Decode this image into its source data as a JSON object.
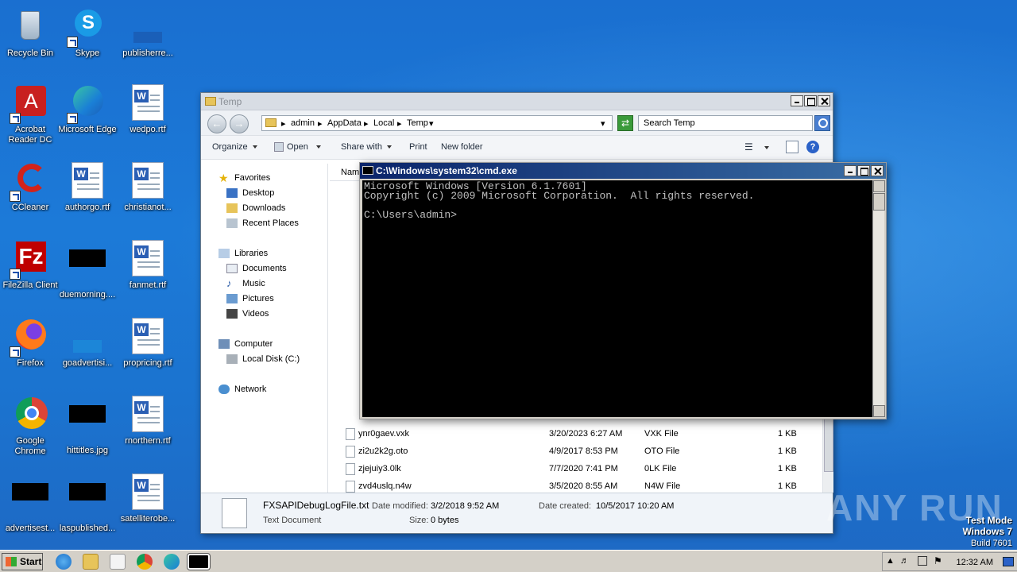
{
  "desktop": {
    "icons": [
      {
        "label": "Recycle Bin",
        "icon": "recycle-bin-icon"
      },
      {
        "label": "Skype",
        "icon": "skype-icon"
      },
      {
        "label": "publisherre...",
        "icon": "file-icon"
      },
      {
        "label": "Acrobat Reader DC",
        "icon": "acrobat-icon"
      },
      {
        "label": "Microsoft Edge",
        "icon": "edge-icon"
      },
      {
        "label": "wedpo.rtf",
        "icon": "word-document-icon"
      },
      {
        "label": "CCleaner",
        "icon": "ccleaner-icon"
      },
      {
        "label": "authorgo.rtf",
        "icon": "word-document-icon"
      },
      {
        "label": "christianot...",
        "icon": "word-document-icon"
      },
      {
        "label": "FileZilla Client",
        "icon": "filezilla-icon"
      },
      {
        "label": "duemorning....",
        "icon": "image-file-icon"
      },
      {
        "label": "fanmet.rtf",
        "icon": "word-document-icon"
      },
      {
        "label": "Firefox",
        "icon": "firefox-icon"
      },
      {
        "label": "goadvertisi...",
        "icon": "file-icon"
      },
      {
        "label": "propricing.rtf",
        "icon": "word-document-icon"
      },
      {
        "label": "Google Chrome",
        "icon": "chrome-icon"
      },
      {
        "label": "hittitles.jpg",
        "icon": "image-file-icon"
      },
      {
        "label": "rnorthern.rtf",
        "icon": "word-document-icon"
      },
      {
        "label": "advertisest...",
        "icon": "image-file-icon"
      },
      {
        "label": "laspublished...",
        "icon": "image-file-icon"
      },
      {
        "label": "satelliterobe...",
        "icon": "word-document-icon"
      }
    ]
  },
  "explorer": {
    "title": "Temp",
    "breadcrumb": [
      "admin",
      "AppData",
      "Local",
      "Temp"
    ],
    "search_placeholder": "Search Temp",
    "toolbar": {
      "organize": "Organize",
      "open": "Open",
      "share_with": "Share with",
      "print": "Print",
      "new_folder": "New folder"
    },
    "nav": {
      "favorites": "Favorites",
      "desktop": "Desktop",
      "downloads": "Downloads",
      "recent_places": "Recent Places",
      "libraries": "Libraries",
      "documents": "Documents",
      "music": "Music",
      "pictures": "Pictures",
      "videos": "Videos",
      "computer": "Computer",
      "local_disk": "Local Disk (C:)",
      "network": "Network"
    },
    "column_name": "Nam",
    "files": [
      {
        "name": "ynr0gaev.vxk",
        "date": "3/20/2023 6:27 AM",
        "type": "VXK File",
        "size": "1 KB"
      },
      {
        "name": "zi2u2k2g.oto",
        "date": "4/9/2017 8:53 PM",
        "type": "OTO File",
        "size": "1 KB"
      },
      {
        "name": "zjejuiy3.0lk",
        "date": "7/7/2020 7:41 PM",
        "type": "0LK File",
        "size": "1 KB"
      },
      {
        "name": "zvd4uslq.n4w",
        "date": "3/5/2020 8:55 AM",
        "type": "N4W File",
        "size": "1 KB"
      }
    ],
    "details": {
      "file_name": "FXSAPIDebugLogFile.txt",
      "modified_label": "Date modified:",
      "modified": "3/2/2018 9:52 AM",
      "created_label": "Date created:",
      "created": "10/5/2017 10:20 AM",
      "type": "Text Document",
      "size_label": "Size:",
      "size": "0 bytes"
    }
  },
  "cmd": {
    "title": "C:\\Windows\\system32\\cmd.exe",
    "line1": "Microsoft Windows [Version 6.1.7601]",
    "line2": "Copyright (c) 2009 Microsoft Corporation.  All rights reserved.",
    "line3": "C:\\Users\\admin>"
  },
  "watermark": {
    "brand": "ANY RUN",
    "test_mode": "Test Mode",
    "os": "Windows 7",
    "build": "Build 7601"
  },
  "taskbar": {
    "start_label": "Start",
    "clock": "12:32 AM"
  }
}
